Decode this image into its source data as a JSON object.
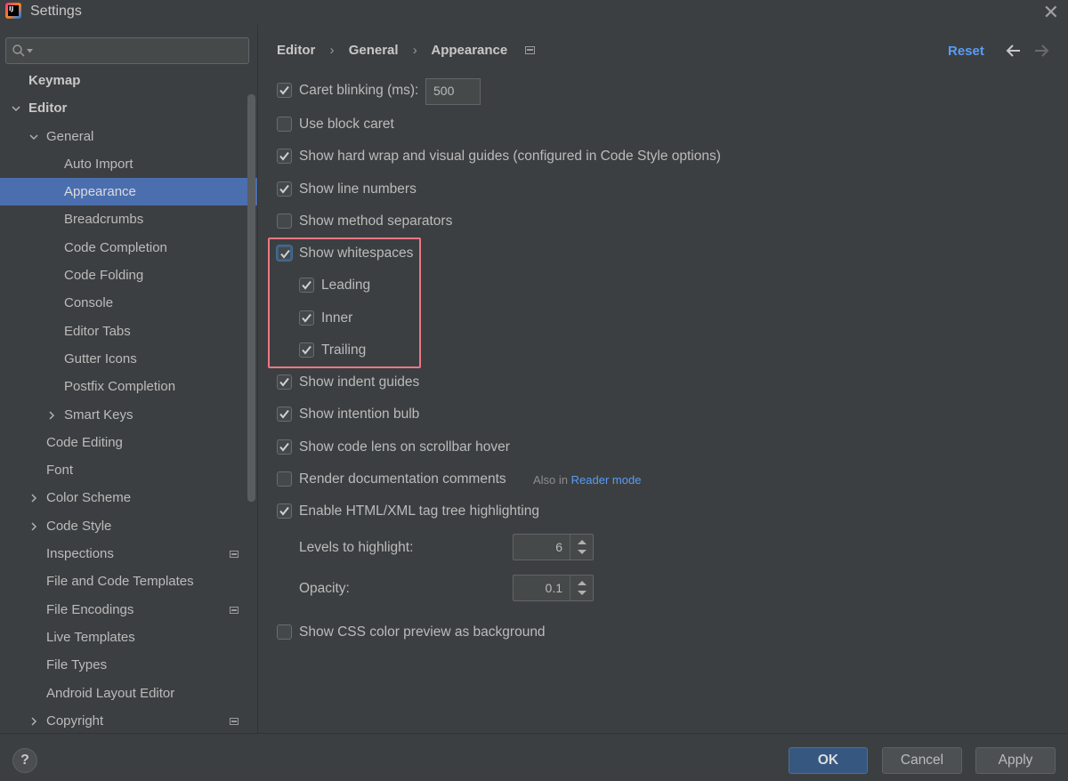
{
  "window": {
    "title": "Settings",
    "app_icon_text": "IJ"
  },
  "search": {
    "placeholder": ""
  },
  "tree": [
    {
      "label": "Keymap",
      "level": 0,
      "bold": true
    },
    {
      "label": "Editor",
      "level": 0,
      "bold": true,
      "expanded": true
    },
    {
      "label": "General",
      "level": 1,
      "expanded": true
    },
    {
      "label": "Auto Import",
      "level": 2
    },
    {
      "label": "Appearance",
      "level": 2,
      "selected": true
    },
    {
      "label": "Breadcrumbs",
      "level": 2
    },
    {
      "label": "Code Completion",
      "level": 2
    },
    {
      "label": "Code Folding",
      "level": 2
    },
    {
      "label": "Console",
      "level": 2
    },
    {
      "label": "Editor Tabs",
      "level": 2
    },
    {
      "label": "Gutter Icons",
      "level": 2
    },
    {
      "label": "Postfix Completion",
      "level": 2
    },
    {
      "label": "Smart Keys",
      "level": 2,
      "collapsed": true
    },
    {
      "label": "Code Editing",
      "level": 1
    },
    {
      "label": "Font",
      "level": 1
    },
    {
      "label": "Color Scheme",
      "level": 1,
      "collapsed": true
    },
    {
      "label": "Code Style",
      "level": 1,
      "collapsed": true
    },
    {
      "label": "Inspections",
      "level": 1,
      "project_icon": true
    },
    {
      "label": "File and Code Templates",
      "level": 1
    },
    {
      "label": "File Encodings",
      "level": 1,
      "project_icon": true
    },
    {
      "label": "Live Templates",
      "level": 1
    },
    {
      "label": "File Types",
      "level": 1
    },
    {
      "label": "Android Layout Editor",
      "level": 1
    },
    {
      "label": "Copyright",
      "level": 1,
      "collapsed": true,
      "project_icon": true
    }
  ],
  "breadcrumb": {
    "items": [
      "Editor",
      "General",
      "Appearance"
    ],
    "separator": "›"
  },
  "header": {
    "reset_label": "Reset"
  },
  "options": [
    {
      "label": "Caret blinking (ms):",
      "checked": true
    },
    {
      "label": "Use block caret",
      "checked": false
    },
    {
      "label": "Show hard wrap and visual guides (configured in Code Style options)",
      "checked": true
    },
    {
      "label": "Show line numbers",
      "checked": true
    },
    {
      "label": "Show method separators",
      "checked": false
    },
    {
      "label": "Show whitespaces",
      "checked": true,
      "focused": true
    },
    {
      "label": "Leading",
      "checked": true,
      "indent": true
    },
    {
      "label": "Inner",
      "checked": true,
      "indent": true
    },
    {
      "label": "Trailing",
      "checked": true,
      "indent": true
    },
    {
      "label": "Show indent guides",
      "checked": true
    },
    {
      "label": "Show intention bulb",
      "checked": true
    },
    {
      "label": "Show code lens on scrollbar hover",
      "checked": true
    },
    {
      "label": "Render documentation comments",
      "checked": false
    },
    {
      "label": "Enable HTML/XML tag tree highlighting",
      "checked": true
    },
    {
      "label": "Show CSS color preview as background",
      "checked": false
    }
  ],
  "caret_blinking_value": "500",
  "also_in": {
    "prefix": "Also in",
    "link": "Reader mode"
  },
  "levels": {
    "label": "Levels to highlight:",
    "value": "6"
  },
  "opacity": {
    "label": "Opacity:",
    "value": "0.1"
  },
  "footer": {
    "help_label": "?",
    "ok_label": "OK",
    "cancel_label": "Cancel",
    "apply_label": "Apply"
  },
  "colors": {
    "selection": "#4b6eaf",
    "link": "#589df6",
    "highlight_border": "#ee7785",
    "primary_button": "#365880"
  }
}
